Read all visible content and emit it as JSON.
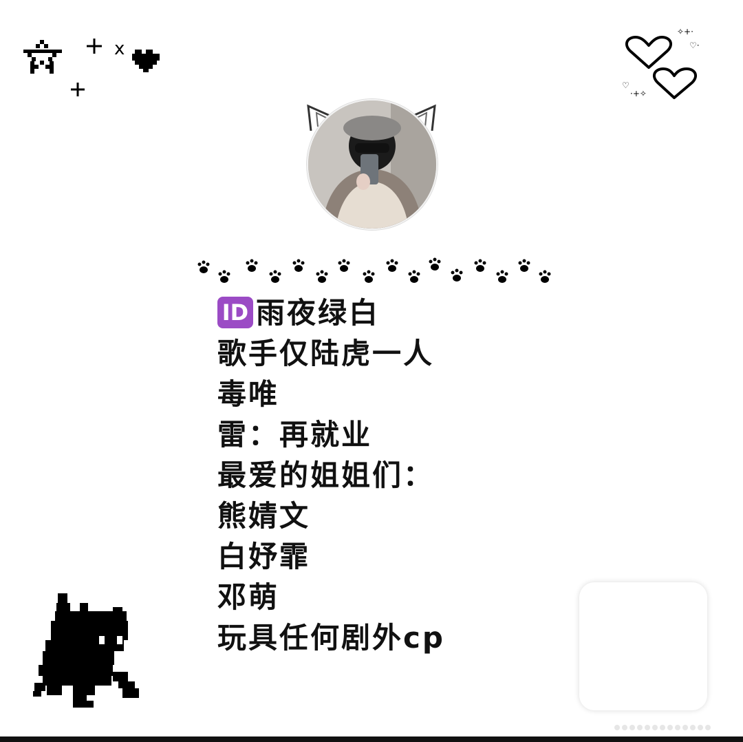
{
  "profile": {
    "id_badge": "ID",
    "lines": [
      "雨夜绿白",
      "歌手仅陆虎一人",
      "毒唯",
      "雷：再就业",
      "最爱的姐姐们：",
      "熊婧文",
      "白妤霏",
      "邓萌",
      "玩具任何剧外cp"
    ]
  },
  "decorations": {
    "top_left_letter": "x",
    "icons": [
      "star-outline-icon",
      "plus-icon",
      "heart-filled-icon",
      "double-heart-icon",
      "paw-print-row",
      "pixel-black-cat"
    ]
  },
  "colors": {
    "text": "#111111",
    "id_badge": "#9b4bc5",
    "background": "#ffffff"
  }
}
